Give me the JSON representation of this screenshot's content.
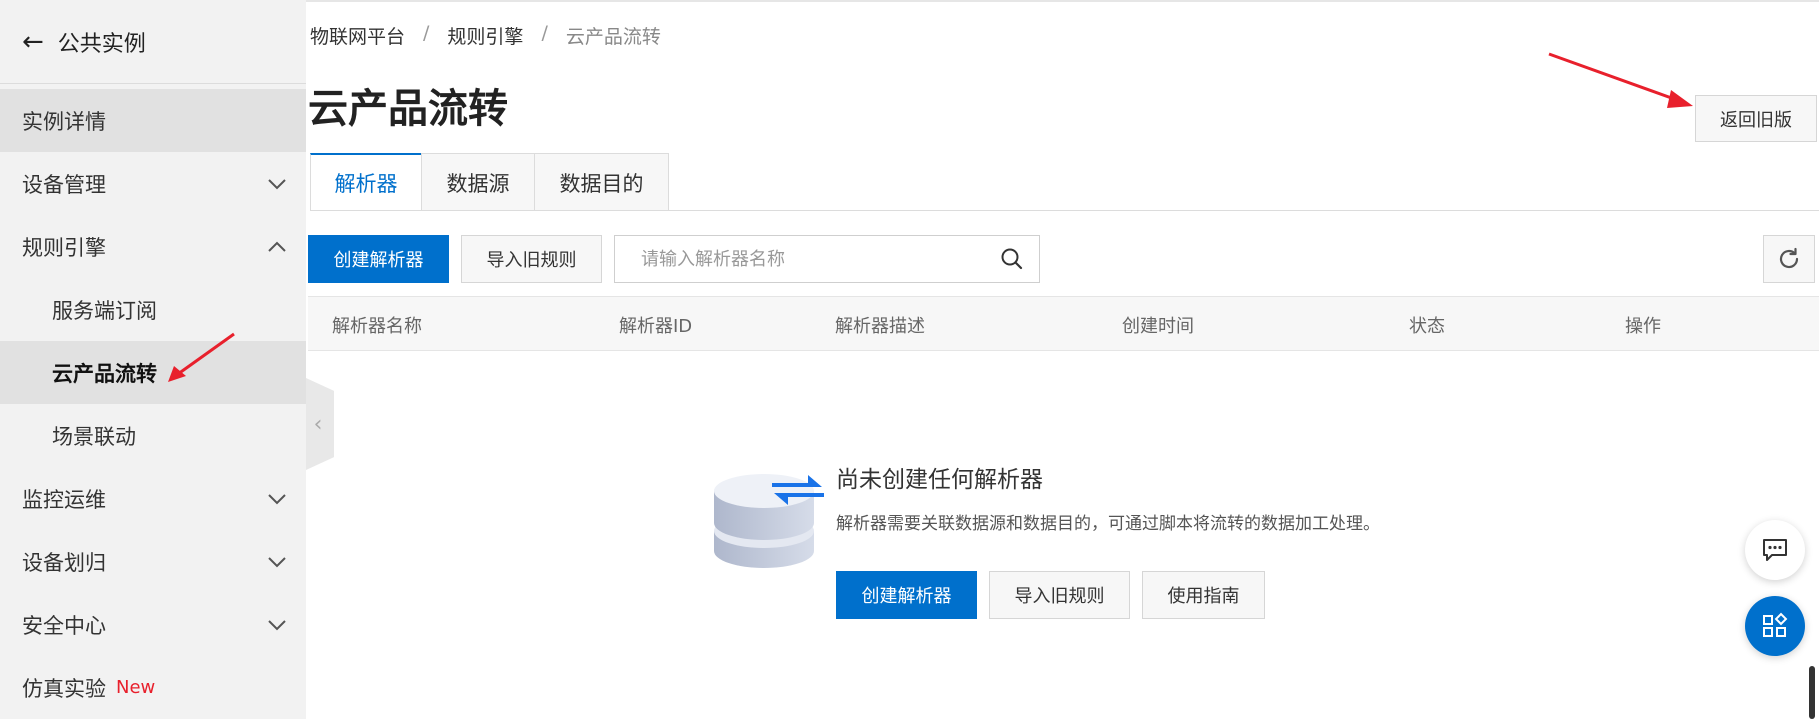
{
  "sidebar": {
    "back_label": "公共实例",
    "items": [
      {
        "label": "实例详情"
      },
      {
        "label": "设备管理"
      },
      {
        "label": "规则引擎"
      },
      {
        "label": "服务端订阅"
      },
      {
        "label": "云产品流转"
      },
      {
        "label": "场景联动"
      },
      {
        "label": "监控运维"
      },
      {
        "label": "设备划归"
      },
      {
        "label": "安全中心"
      },
      {
        "label": "仿真实验",
        "badge": "New"
      }
    ]
  },
  "breadcrumb": [
    "物联网平台",
    "规则引擎",
    "云产品流转"
  ],
  "breadcrumb_sep": "/",
  "page_title": "云产品流转",
  "old_version_button": "返回旧版",
  "tabs": [
    {
      "label": "解析器",
      "active": true
    },
    {
      "label": "数据源",
      "active": false
    },
    {
      "label": "数据目的",
      "active": false
    }
  ],
  "toolbar": {
    "create_label": "创建解析器",
    "import_label": "导入旧规则",
    "search_placeholder": "请输入解析器名称"
  },
  "table": {
    "columns": [
      "解析器名称",
      "解析器ID",
      "解析器描述",
      "创建时间",
      "状态",
      "操作"
    ]
  },
  "empty_state": {
    "title": "尚未创建任何解析器",
    "description": "解析器需要关联数据源和数据目的，可通过脚本将流转的数据加工处理。",
    "create_label": "创建解析器",
    "import_label": "导入旧规则",
    "guide_label": "使用指南"
  },
  "colors": {
    "primary": "#0070cc",
    "badge_new": "#e8202c",
    "annotation": "#e8202c"
  },
  "icons": [
    "arrow-left-icon",
    "chevron-down-icon",
    "chevron-up-icon",
    "search-icon",
    "refresh-icon",
    "database-sync-icon",
    "chat-icon",
    "app-grid-icon"
  ]
}
